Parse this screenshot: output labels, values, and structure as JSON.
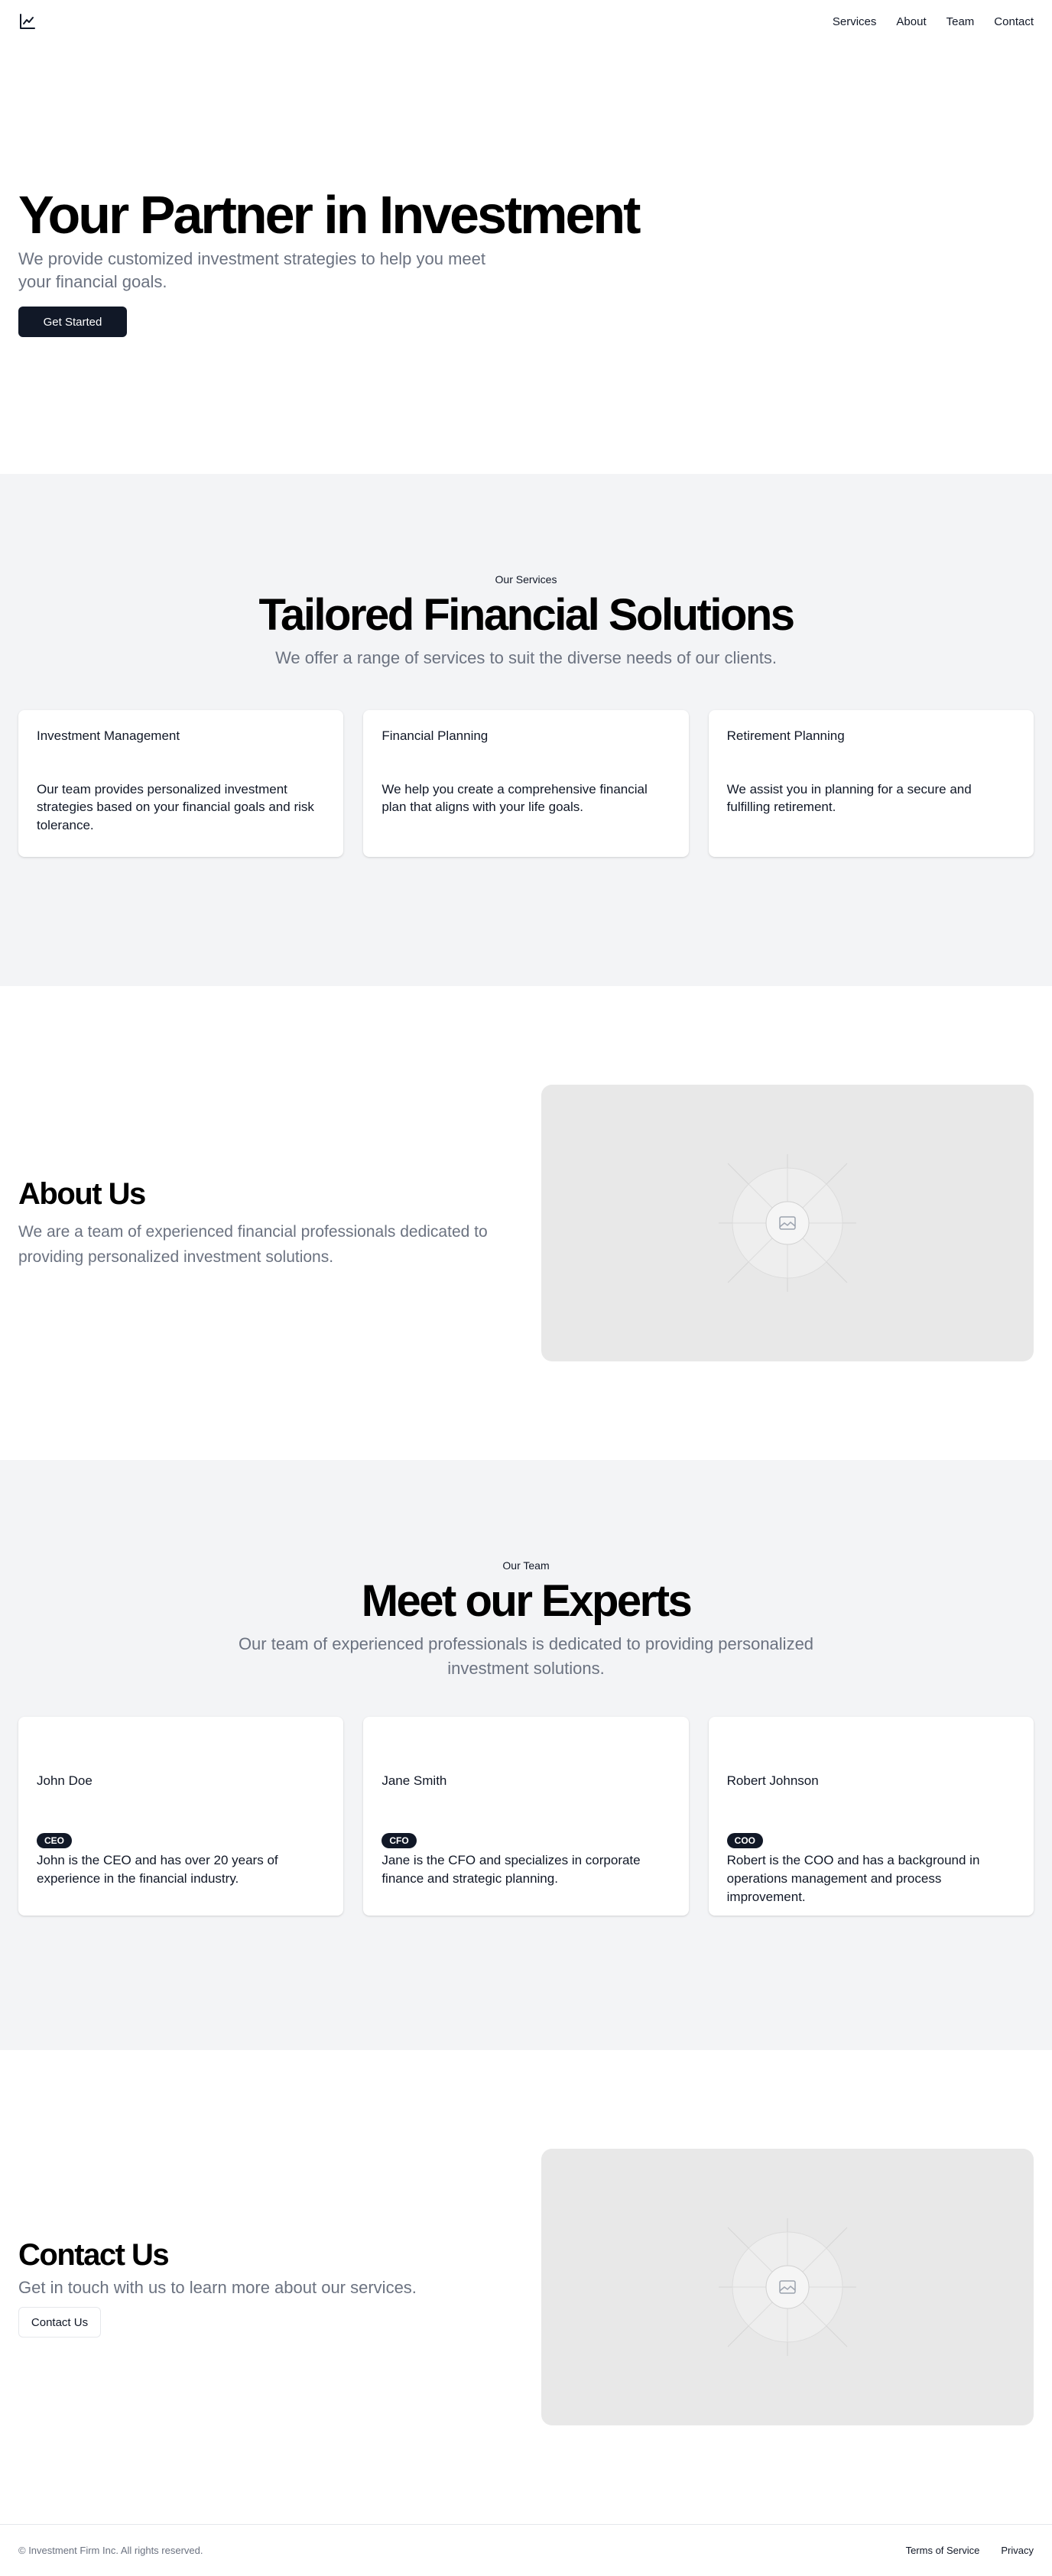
{
  "header": {
    "logo_icon": "chart-line-icon",
    "nav": [
      "Services",
      "About",
      "Team",
      "Contact"
    ]
  },
  "hero": {
    "title": "Your Partner in Investment",
    "subtitle": "We provide customized investment strategies to help you meet your financial goals.",
    "cta": "Get Started"
  },
  "services": {
    "eyebrow": "Our Services",
    "title": "Tailored Financial Solutions",
    "subtitle": "We offer a range of services to suit the diverse needs of our clients.",
    "cards": [
      {
        "title": "Investment Management",
        "text": "Our team provides personalized investment strategies based on your financial goals and risk tolerance."
      },
      {
        "title": "Financial Planning",
        "text": "We help you create a comprehensive financial plan that aligns with your life goals."
      },
      {
        "title": "Retirement Planning",
        "text": "We assist you in planning for a secure and fulfilling retirement."
      }
    ]
  },
  "about": {
    "title": "About Us",
    "text": "We are a team of experienced financial professionals dedicated to providing personalized investment solutions.",
    "image_icon": "image-placeholder-icon"
  },
  "team": {
    "eyebrow": "Our Team",
    "title": "Meet our Experts",
    "subtitle": "Our team of experienced professionals is dedicated to providing personalized investment solutions.",
    "members": [
      {
        "name": "John Doe",
        "role": "CEO",
        "bio": "John is the CEO and has over 20 years of experience in the financial industry."
      },
      {
        "name": "Jane Smith",
        "role": "CFO",
        "bio": "Jane is the CFO and specializes in corporate finance and strategic planning."
      },
      {
        "name": "Robert Johnson",
        "role": "COO",
        "bio": "Robert is the COO and has a background in operations management and process improvement."
      }
    ]
  },
  "contact": {
    "title": "Contact Us",
    "text": "Get in touch with us to learn more about our services.",
    "cta": "Contact Us",
    "image_icon": "image-placeholder-icon"
  },
  "footer": {
    "copyright": "© Investment Firm Inc. All rights reserved.",
    "links": [
      "Terms of Service",
      "Privacy"
    ]
  },
  "colors": {
    "primary": "#111827",
    "muted_text": "#6b7280",
    "section_bg": "#f3f4f6",
    "placeholder_bg": "#e8e8e8"
  }
}
